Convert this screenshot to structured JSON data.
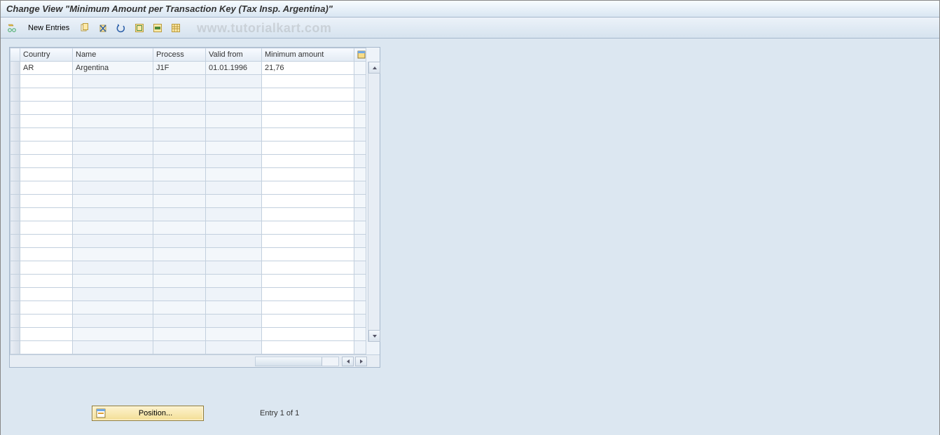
{
  "title": "Change View \"Minimum Amount per Transaction Key (Tax Insp. Argentina)\"",
  "watermark": "www.tutorialkart.com",
  "toolbar": {
    "new_entries_label": "New Entries",
    "icons": {
      "toggle": "toggle-change-display",
      "copy": "copy-as",
      "delete": "delete",
      "undo": "undo-change",
      "select_all": "select-all",
      "deselect_all": "select-block",
      "config": "table-settings"
    }
  },
  "columns": {
    "country": "Country",
    "name": "Name",
    "process": "Process",
    "valid_from": "Valid from",
    "min_amount": "Minimum amount"
  },
  "rows": [
    {
      "country": "AR",
      "name": "Argentina",
      "process": "J1F",
      "valid_from": "01.01.1996",
      "min_amount": "21,76"
    }
  ],
  "empty_row_count": 21,
  "footer": {
    "position_label": "Position...",
    "entry_text": "Entry 1 of 1"
  }
}
